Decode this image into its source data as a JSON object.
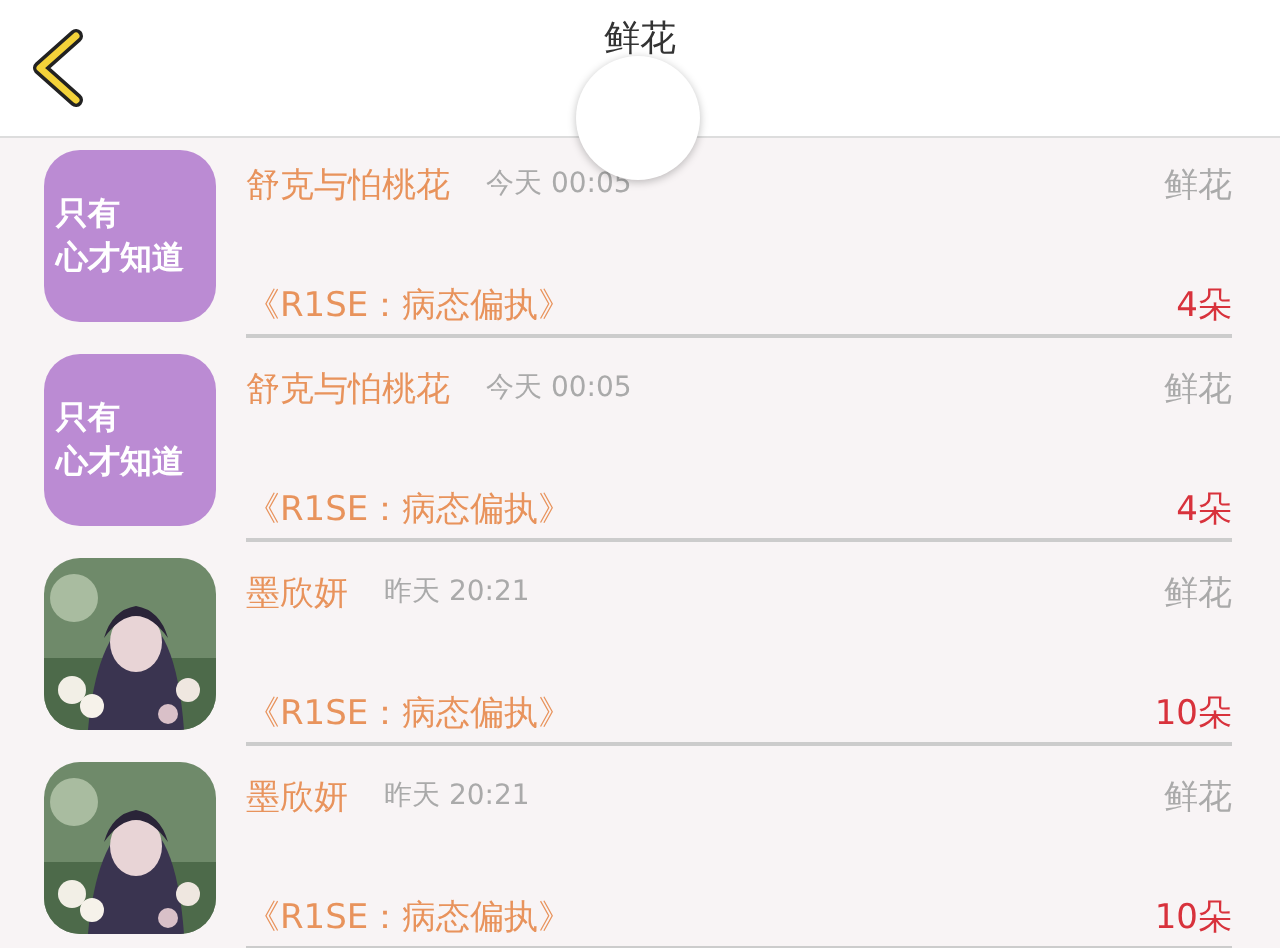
{
  "header": {
    "title": "鲜花"
  },
  "records": [
    {
      "avatar": {
        "kind": "text",
        "lines": [
          "只有",
          "心才知道"
        ]
      },
      "name": "舒克与怕桃花",
      "time": "今天 00:05",
      "type": "鲜花",
      "item": "《R1SE：病态偏执》",
      "count": "4朵"
    },
    {
      "avatar": {
        "kind": "text",
        "lines": [
          "只有",
          "心才知道"
        ]
      },
      "name": "舒克与怕桃花",
      "time": "今天 00:05",
      "type": "鲜花",
      "item": "《R1SE：病态偏执》",
      "count": "4朵"
    },
    {
      "name": "墨欣妍",
      "time": "昨天 20:21",
      "type": "鲜花",
      "item": "《R1SE：病态偏执》",
      "count": "10朵"
    },
    {
      "name": "墨欣妍",
      "time": "昨天 20:21",
      "type": "鲜花",
      "item": "《R1SE：病态偏执》",
      "count": "10朵"
    }
  ]
}
